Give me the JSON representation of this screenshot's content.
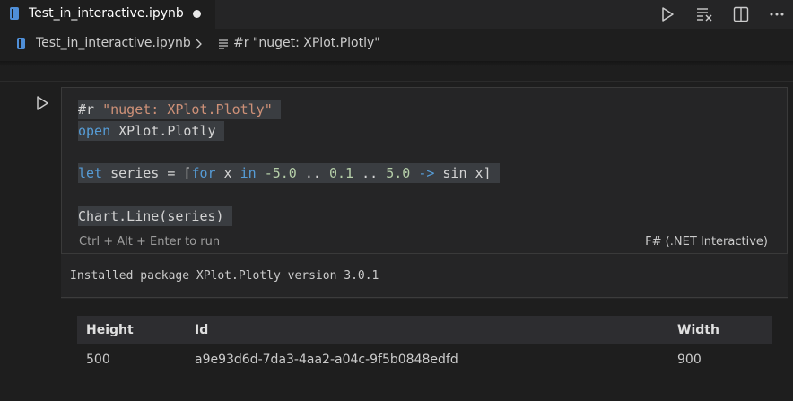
{
  "tab": {
    "title": "Test_in_interactive.ipynb"
  },
  "breadcrumb": {
    "file": "Test_in_interactive.ipynb",
    "symbol": "#r \"nuget: XPlot.Plotly\""
  },
  "cell": {
    "code_lines": [
      "#r \"nuget: XPlot.Plotly\"",
      "open XPlot.Plotly",
      "",
      "let series = [for x in -5.0 .. 0.1 .. 5.0 -> sin x]",
      "",
      "Chart.Line(series)"
    ],
    "hint": "Ctrl + Alt + Enter to run",
    "language": "F# (.NET Interactive)"
  },
  "output": {
    "installed": "Installed package XPlot.Plotly version 3.0.1",
    "table": {
      "headers": [
        "Height",
        "Id",
        "Width"
      ],
      "row": [
        "500",
        "a9e93d6d-7da3-4aa2-a04c-9f5b0848edfd",
        "900"
      ]
    }
  }
}
